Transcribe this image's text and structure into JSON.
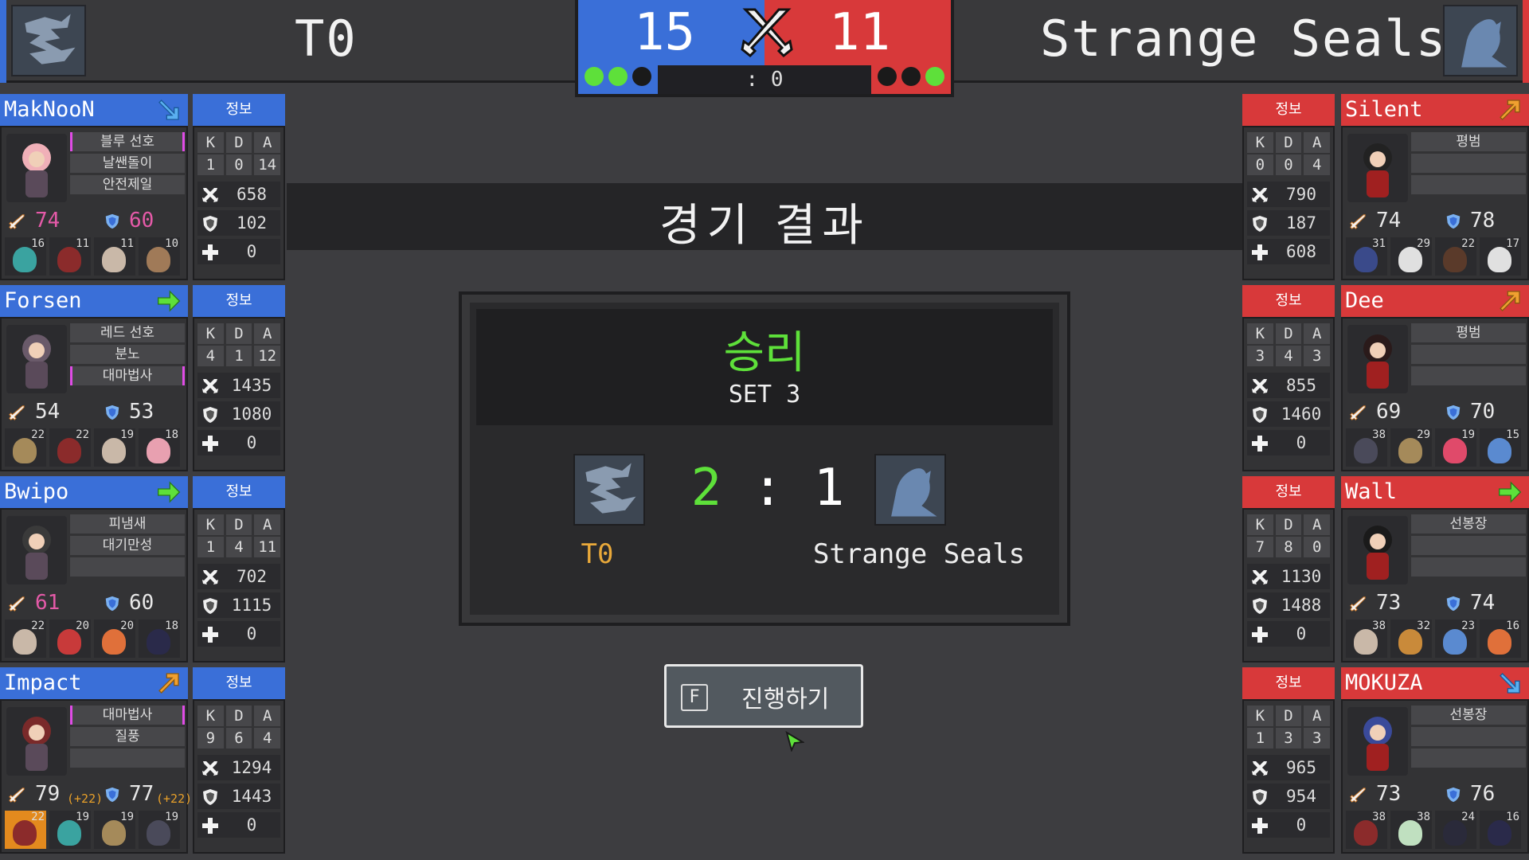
{
  "top": {
    "blue_team": "T0",
    "red_team": "Strange Seals",
    "blue_kills": "15",
    "red_kills": "11",
    "timer": ": 0",
    "blue_dots": [
      true,
      true,
      false
    ],
    "red_dots": [
      false,
      false,
      true
    ]
  },
  "info_label": "정보",
  "kda_head": [
    "K",
    "D",
    "A"
  ],
  "blue_players": [
    {
      "name": "MakNooN",
      "arrow": "down-right",
      "tags": [
        {
          "t": "블루 선호",
          "pink": true
        },
        {
          "t": "날쌘돌이",
          "pink": false
        },
        {
          "t": "안전제일",
          "pink": false
        }
      ],
      "atk": "74",
      "def": "60",
      "atk_pink": true,
      "def_pink": true,
      "atk_bonus": "",
      "def_bonus": "",
      "kda": [
        "1",
        "0",
        "14"
      ],
      "dmg": "658",
      "taken": "102",
      "heal": "0",
      "mini": [
        {
          "v": "16",
          "c": "#3aa3a0"
        },
        {
          "v": "11",
          "c": "#8b2b2b"
        },
        {
          "v": "11",
          "c": "#c9b8a8"
        },
        {
          "v": "10",
          "c": "#a07a58"
        }
      ],
      "mini_hl": false
    },
    {
      "name": "Forsen",
      "arrow": "right",
      "tags": [
        {
          "t": "레드 선호",
          "pink": false
        },
        {
          "t": "분노",
          "pink": false
        },
        {
          "t": "대마법사",
          "pink": true
        }
      ],
      "atk": "54",
      "def": "53",
      "atk_pink": false,
      "def_pink": false,
      "atk_bonus": "",
      "def_bonus": "",
      "kda": [
        "4",
        "1",
        "12"
      ],
      "dmg": "1435",
      "taken": "1080",
      "heal": "0",
      "mini": [
        {
          "v": "22",
          "c": "#a58a5a"
        },
        {
          "v": "22",
          "c": "#8b2b2b"
        },
        {
          "v": "19",
          "c": "#c9b8a8"
        },
        {
          "v": "18",
          "c": "#e8a0b0"
        }
      ],
      "mini_hl": false
    },
    {
      "name": "Bwipo",
      "arrow": "right",
      "tags": [
        {
          "t": "피냄새",
          "pink": false
        },
        {
          "t": "대기만성",
          "pink": false
        },
        {
          "t": "",
          "pink": false
        }
      ],
      "atk": "61",
      "def": "60",
      "atk_pink": true,
      "def_pink": false,
      "atk_bonus": "",
      "def_bonus": "",
      "kda": [
        "1",
        "4",
        "11"
      ],
      "dmg": "702",
      "taken": "1115",
      "heal": "0",
      "mini": [
        {
          "v": "22",
          "c": "#c9b8a8"
        },
        {
          "v": "20",
          "c": "#c83a3a"
        },
        {
          "v": "20",
          "c": "#e0703a"
        },
        {
          "v": "18",
          "c": "#2a2a4a"
        }
      ],
      "mini_hl": false
    },
    {
      "name": "Impact",
      "arrow": "up-right",
      "tags": [
        {
          "t": "대마법사",
          "pink": true
        },
        {
          "t": "질풍",
          "pink": false
        },
        {
          "t": "",
          "pink": false
        }
      ],
      "atk": "79",
      "def": "77",
      "atk_pink": false,
      "def_pink": false,
      "atk_bonus": "(+22)",
      "def_bonus": "(+22)",
      "kda": [
        "9",
        "6",
        "4"
      ],
      "dmg": "1294",
      "taken": "1443",
      "heal": "0",
      "mini": [
        {
          "v": "22",
          "c": "#8b2b2b"
        },
        {
          "v": "19",
          "c": "#3aa3a0"
        },
        {
          "v": "19",
          "c": "#a58a5a"
        },
        {
          "v": "19",
          "c": "#4a4a5a"
        }
      ],
      "mini_hl": true
    }
  ],
  "red_players": [
    {
      "name": "Silent",
      "arrow": "up-right",
      "tags": [
        {
          "t": "평범",
          "pink": false
        },
        {
          "t": "",
          "pink": false
        },
        {
          "t": "",
          "pink": false
        }
      ],
      "atk": "74",
      "def": "78",
      "atk_bonus": "",
      "def_bonus": "",
      "kda": [
        "0",
        "0",
        "4"
      ],
      "dmg": "790",
      "taken": "187",
      "heal": "608",
      "mini": [
        {
          "v": "31",
          "c": "#3a4a8a"
        },
        {
          "v": "29",
          "c": "#e0e0e0"
        },
        {
          "v": "22",
          "c": "#5a3a2a"
        },
        {
          "v": "17",
          "c": "#e0e0e0"
        }
      ]
    },
    {
      "name": "Dee",
      "arrow": "up-right",
      "tags": [
        {
          "t": "평범",
          "pink": false
        },
        {
          "t": "",
          "pink": false
        },
        {
          "t": "",
          "pink": false
        }
      ],
      "atk": "69",
      "def": "70",
      "atk_bonus": "",
      "def_bonus": "",
      "kda": [
        "3",
        "4",
        "3"
      ],
      "dmg": "855",
      "taken": "1460",
      "heal": "0",
      "mini": [
        {
          "v": "38",
          "c": "#4a4a5a"
        },
        {
          "v": "29",
          "c": "#a58a5a"
        },
        {
          "v": "19",
          "c": "#e04a6a"
        },
        {
          "v": "15",
          "c": "#5a8ad0"
        }
      ]
    },
    {
      "name": "Wall",
      "arrow": "right",
      "tags": [
        {
          "t": "선봉장",
          "pink": false
        },
        {
          "t": "",
          "pink": false
        },
        {
          "t": "",
          "pink": false
        }
      ],
      "atk": "73",
      "def": "74",
      "atk_bonus": "",
      "def_bonus": "",
      "kda": [
        "7",
        "8",
        "0"
      ],
      "dmg": "1130",
      "taken": "1488",
      "heal": "0",
      "mini": [
        {
          "v": "38",
          "c": "#c9b8a8"
        },
        {
          "v": "32",
          "c": "#c98a3a"
        },
        {
          "v": "23",
          "c": "#5a8ad0"
        },
        {
          "v": "16",
          "c": "#e0703a"
        }
      ]
    },
    {
      "name": "MOKUZA",
      "arrow": "down-right",
      "tags": [
        {
          "t": "선봉장",
          "pink": false
        },
        {
          "t": "",
          "pink": false
        },
        {
          "t": "",
          "pink": false
        }
      ],
      "atk": "73",
      "def": "76",
      "atk_bonus": "",
      "def_bonus": "",
      "kda": [
        "1",
        "3",
        "3"
      ],
      "dmg": "965",
      "taken": "954",
      "heal": "0",
      "mini": [
        {
          "v": "38",
          "c": "#8b2b2b"
        },
        {
          "v": "38",
          "c": "#c0e0c0"
        },
        {
          "v": "24",
          "c": "#2a2a3a"
        },
        {
          "v": "16",
          "c": "#2a2a4a"
        }
      ]
    }
  ],
  "center": {
    "title": "경기 결과",
    "victory": "승리",
    "set_label": "SET 3",
    "blue_sets": "2",
    "separator": ":",
    "red_sets": "1",
    "blue_team": "T0",
    "red_team": "Strange Seals",
    "proceed_key": "F",
    "proceed_label": "진행하기"
  },
  "colors": {
    "blue": "#3a6fd8",
    "red": "#d8393a",
    "green": "#5ee03a",
    "pink": "#e55aa8",
    "gold": "#e8a83a"
  },
  "icons": {
    "blue_logo": "dragon-emblem",
    "red_logo": "seal-emblem",
    "attack": "sword-icon",
    "defense": "shield-icon",
    "heal": "plus-icon",
    "battle": "crossed-swords-icon"
  }
}
